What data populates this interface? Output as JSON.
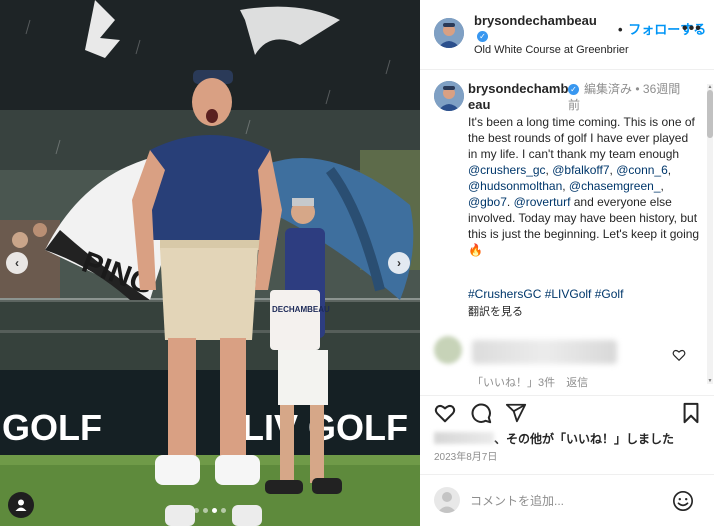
{
  "post": {
    "username": "brysondechambeau",
    "location": "Old White Course at Greenbrier",
    "follow_separator": "•",
    "follow_label": "フォローする",
    "more_label": "•••"
  },
  "caption": {
    "username": "brysondechambeau",
    "edited_label": "編集済み",
    "separator": "•",
    "time_ago": "36週間前",
    "text_segments": [
      "It's been a long time coming. This is one of the best rounds of golf I have ever played in my life. I can't thank my team enough ",
      "@crushers_gc",
      ", ",
      "@bfalkoff7",
      ", ",
      "@conn_6",
      ", ",
      "@hudsonmolthan",
      ", ",
      "@chasemgreen_",
      ", ",
      "@gbo7",
      ". ",
      "@roverturf",
      " and everyone else involved. Today may have been history, but this is just the beginning. Let's keep it going "
    ],
    "fire_emoji": "🔥",
    "hashtags": "#CrushersGC #LIVGolf #Golf",
    "translate_label": "翻訳を見る"
  },
  "comment": {
    "likes_label": "「いいね！」3件",
    "reply_label": "返信"
  },
  "likes": {
    "text": "、その他が「いいね！」しました"
  },
  "date": "2023年8月7日",
  "comment_input": {
    "placeholder": "コメントを追加..."
  },
  "media": {
    "banner_text_left": "GOLF",
    "banner_text_right": "LIV GOLF",
    "umbrella_text": "PING",
    "caddie_bib": "DECHAMBEAU",
    "carousel_dot_count": 4,
    "carousel_active_index": 2
  },
  "colors": {
    "accent": "#0095f6",
    "verified": "#3897f0",
    "link": "#00376b",
    "muted": "#8e8e8e"
  },
  "icons": {
    "heart": "heart-icon",
    "comment": "comment-icon",
    "share": "share-icon",
    "save": "bookmark-icon",
    "emoji": "emoji-icon",
    "tag": "user-tag-icon"
  }
}
